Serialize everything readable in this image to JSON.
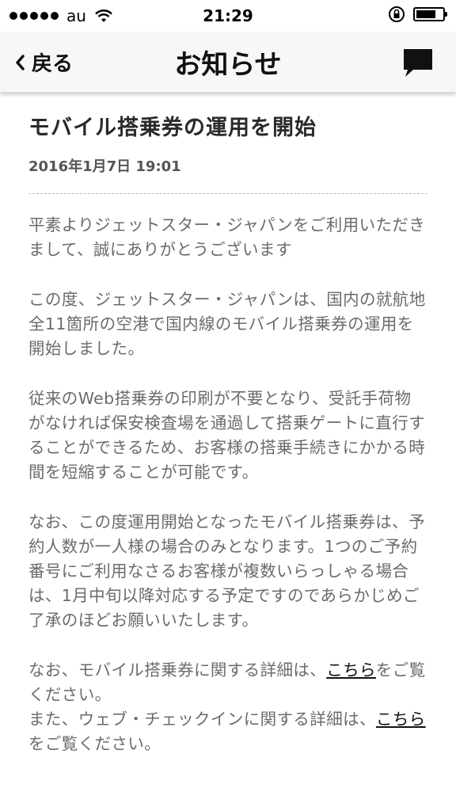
{
  "status_bar": {
    "carrier": "au",
    "time": "21:29",
    "battery_level": 0.75
  },
  "nav": {
    "back_label": "戻る",
    "title": "お知らせ"
  },
  "article": {
    "title": "モバイル搭乗券の運用を開始",
    "date": "2016年1月7日 19:01",
    "paragraphs": [
      "平素よりジェットスター・ジャパンをご利用いただきまして、誠にありがとうございます",
      "この度、ジェットスター・ジャパンは、国内の就航地全11箇所の空港で国内線のモバイル搭乗券の運用を開始しました。",
      "従来のWeb搭乗券の印刷が不要となり、受託手荷物がなければ保安検査場を通過して搭乗ゲートに直行することができるため、お客様の搭乗手続きにかかる時間を短縮することが可能です。",
      "なお、この度運用開始となったモバイル搭乗券は、予約人数が一人様の場合のみとなります。1つのご予約番号にご利用なさるお客様が複数いらっしゃる場合は、1月中旬以降対応する予定ですのであらかじめご了承のほどお願いいたします。"
    ],
    "final": {
      "line1_prefix": "なお、モバイル搭乗券に関する詳細は、",
      "line1_link": "こちら",
      "line1_suffix": "をご覧ください。",
      "line2_prefix": "また、ウェブ・チェックインに関する詳細は、",
      "line2_link": "こちら",
      "line2_suffix": "をご覧ください。"
    }
  }
}
